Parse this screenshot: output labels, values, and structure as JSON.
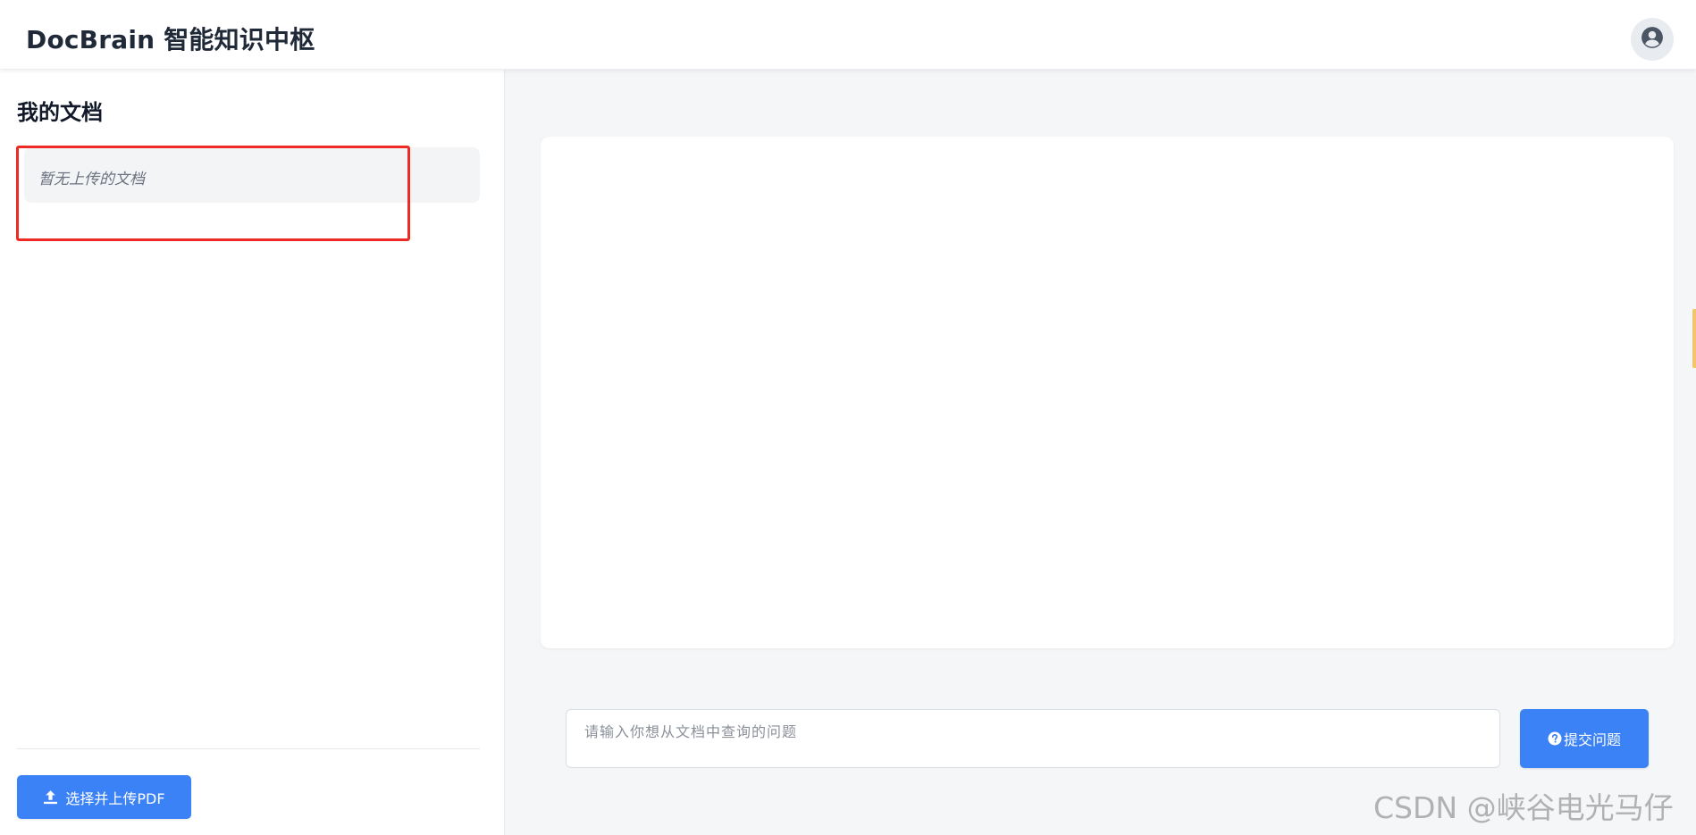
{
  "header": {
    "app_title": "DocBrain 智能知识中枢",
    "avatar_icon": "user-circle-icon"
  },
  "sidebar": {
    "title": "我的文档",
    "empty_text": "暂无上传的文档",
    "upload_button": {
      "label": "选择并上传PDF",
      "icon": "upload-icon"
    }
  },
  "main": {
    "question_input": {
      "value": "",
      "placeholder": "请输入你想从文档中查询的问题"
    },
    "submit_button": {
      "label": "提交问题",
      "icon": "question-circle-icon"
    }
  },
  "annotation": {
    "highlight_color": "#ef2a24"
  },
  "watermark": "CSDN @峡谷电光马仔",
  "colors": {
    "accent": "#3b82f6",
    "main_bg": "#f5f6f8"
  }
}
